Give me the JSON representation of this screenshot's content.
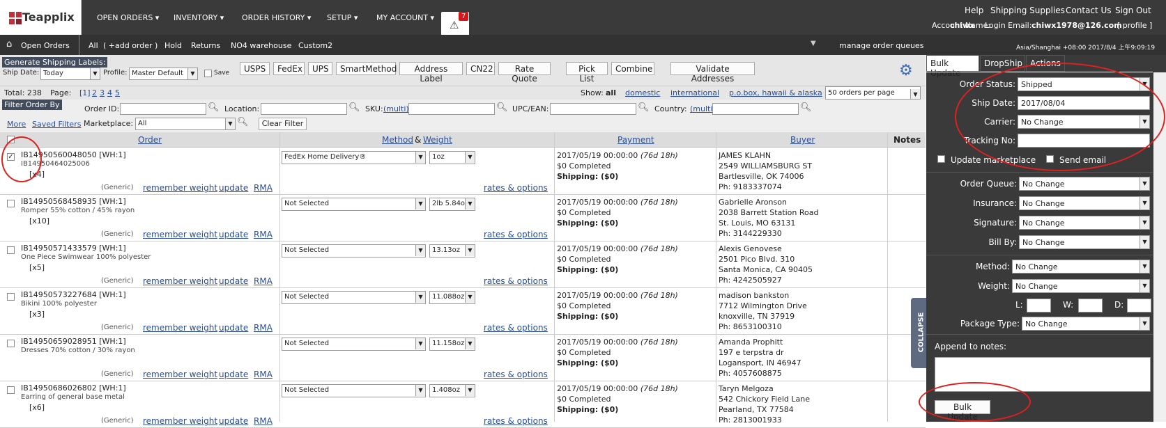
{
  "brand": {
    "name": "Teapplix"
  },
  "nav": {
    "open_orders": "OPEN ORDERS ▾",
    "inventory": "INVENTORY ▾",
    "order_history": "ORDER HISTORY ▾",
    "setup": "SETUP ▾",
    "my_account": "MY ACCOUNT ▾",
    "alert_count": "7"
  },
  "toplinks": {
    "help": "Help",
    "supplies": "Shipping Supplies",
    "contact": "Contact Us",
    "signout": "Sign Out"
  },
  "account": {
    "name_label": "Account Name:",
    "name": "chiwx",
    "email_label": "Login Email:",
    "email": "chiwx1978@126.com",
    "profile": "[ profile ]"
  },
  "subnav": {
    "open_orders": "Open Orders",
    "all": "All",
    "add_order": "( +add order )",
    "hold": "Hold",
    "returns": "Returns",
    "no4": "NO4 warehouse",
    "custom2": "Custom2",
    "manage": "manage order queues",
    "tz": "Asia/Shanghai +08:00 2017/8/4 上午9:09:19"
  },
  "toolbar": {
    "gen_label": "Generate Shipping Labels:",
    "ship_date_label": "Ship Date:",
    "ship_date": "Today",
    "profile_label": "Profile:",
    "profile": "Master Default",
    "save_label": "Save",
    "buttons": [
      "USPS",
      "FedEx",
      "UPS",
      "SmartMethod",
      "Address Label",
      "CN22",
      "Rate Quote",
      "Pick List",
      "Combine",
      "Validate Addresses"
    ]
  },
  "totals": {
    "total": "Total: 238",
    "page_label": "Page:",
    "pages": [
      "[1]",
      "2",
      "3",
      "4",
      "5"
    ],
    "show": "Show:",
    "all": "all",
    "domestic": "domestic",
    "international": "international",
    "pobox": "p.o.box, hawaii & alaska",
    "per_page": "50 orders per page"
  },
  "filter": {
    "title": "Filter Order By",
    "order_id": "Order ID:",
    "location": "Location:",
    "sku": "SKU:",
    "multi": "(multi)",
    "upc": "UPC/EAN:",
    "country": "Country:",
    "more": "More",
    "saved": "Saved Filters",
    "marketplace": "Marketplace:",
    "marketplace_val": "All",
    "clear": "Clear Filter"
  },
  "table": {
    "order": "Order",
    "method": "Method",
    "amp": "&",
    "weight": "Weight",
    "payment": "Payment",
    "buyer": "Buyer",
    "notes": "Notes",
    "generic": "(Generic)",
    "remember": "remember weight",
    "update": "update",
    "rma": "RMA",
    "rates": "rates & options",
    "rows": [
      {
        "id": "IB14950560048050  [WH:1]",
        "desc": "IB14950464025006",
        "qty": "[x4]",
        "method": "FedEx Home Delivery®",
        "weight": "1oz",
        "date": "2017/05/19 00:00:00",
        "age": "(76d 18h)",
        "completed": "$0 Completed",
        "shipping": "Shipping: ($0)",
        "name": "JAMES KLAHN",
        "addr1": "2549 WILLIAMSBURG ST",
        "addr2": "Bartlesville, OK 74006",
        "phone": "Ph: 9183337074",
        "checked": true
      },
      {
        "id": "IB14950568458935  [WH:1]",
        "desc": "Romper 55% cotton / 45% rayon",
        "qty": "[x10]",
        "method": "Not Selected",
        "weight": "2lb 5.84o",
        "date": "2017/05/19 00:00:00",
        "age": "(76d 18h)",
        "completed": "$0 Completed",
        "shipping": "Shipping: ($0)",
        "name": "Gabrielle Aronson",
        "addr1": "2038 Barrett Station Road",
        "addr2": "St. Louis, MO 63131",
        "phone": "Ph: 3144229330",
        "checked": false
      },
      {
        "id": "IB14950571433579  [WH:1]",
        "desc": "One Piece Swimwear 100% polyester",
        "qty": "[x5]",
        "method": "Not Selected",
        "weight": "13.13oz",
        "date": "2017/05/19 00:00:00",
        "age": "(76d 18h)",
        "completed": "$0 Completed",
        "shipping": "Shipping: ($0)",
        "name": "Alexis Genovese",
        "addr1": "2501 Pico Blvd. 310",
        "addr2": "Santa Monica, CA 90405",
        "phone": "Ph: 4242505927",
        "checked": false
      },
      {
        "id": "IB14950573227684  [WH:1]",
        "desc": "Bikini 100% polyester",
        "qty": "[x3]",
        "method": "Not Selected",
        "weight": "11.088oz",
        "date": "2017/05/19 00:00:00",
        "age": "(76d 18h)",
        "completed": "$0 Completed",
        "shipping": "Shipping: ($0)",
        "name": "madison bankston",
        "addr1": "7712 Wilmington Drive",
        "addr2": "knoxville, TN 37919",
        "phone": "Ph: 8653100310",
        "checked": false
      },
      {
        "id": "IB14950659028951  [WH:1]",
        "desc": "Dresses 70% cotton / 30% rayon",
        "qty": "",
        "method": "Not Selected",
        "weight": "11.158oz",
        "date": "2017/05/19 00:00:00",
        "age": "(76d 18h)",
        "completed": "$0 Completed",
        "shipping": "Shipping: ($0)",
        "name": "Amanda Prophitt",
        "addr1": "197 e terpstra dr",
        "addr2": "Logansport, IN 46947",
        "phone": "Ph: 4057608875",
        "checked": false
      },
      {
        "id": "IB14950686026802  [WH:1]",
        "desc": "Earring of general base metal",
        "qty": "[x6]",
        "method": "Not Selected",
        "weight": "1.408oz",
        "date": "2017/05/19 00:00:00",
        "age": "(76d 18h)",
        "completed": "$0 Completed",
        "shipping": "Shipping: ($0)",
        "name": "Taryn Melgoza",
        "addr1": "542 Chickory Field Lane",
        "addr2": "Pearland, TX 77584",
        "phone": "Ph: 2813001933",
        "checked": false
      }
    ]
  },
  "panel": {
    "tabs": [
      "Bulk Update",
      "DropShip",
      "Actions"
    ],
    "order_status": "Order Status:",
    "order_status_val": "Shipped",
    "ship_date": "Ship Date:",
    "ship_date_val": "2017/08/04",
    "carrier": "Carrier:",
    "carrier_val": "No Change",
    "tracking": "Tracking No:",
    "update_mp": "Update marketplace",
    "send_email": "Send email",
    "order_queue": "Order Queue:",
    "insurance": "Insurance:",
    "signature": "Signature:",
    "bill_by": "Bill By:",
    "method": "Method:",
    "weight": "Weight:",
    "l": "L:",
    "w": "W:",
    "d": "D:",
    "package": "Package Type:",
    "no_change": "No Change",
    "append": "Append to notes:",
    "bulk_btn": "Bulk Update",
    "collapse": "COLLAPSE"
  },
  "colors": {
    "topbar": "#3a3a3a",
    "panel": "#3a3a3a",
    "link": "#2a4d99",
    "annotation": "#e02020"
  }
}
